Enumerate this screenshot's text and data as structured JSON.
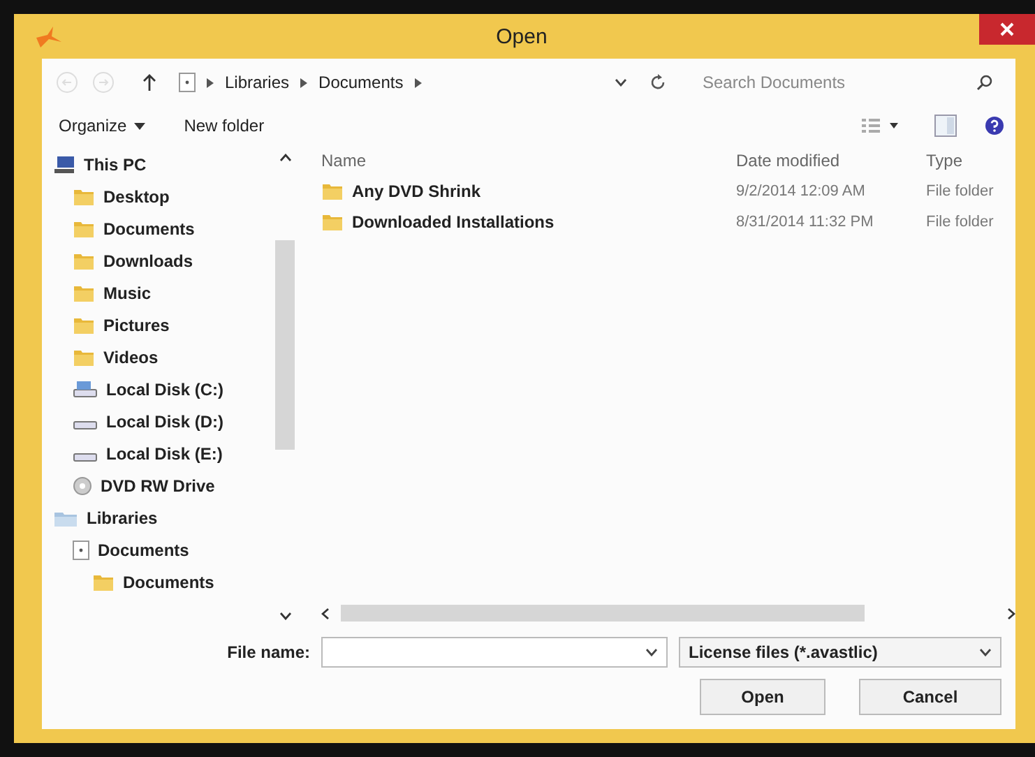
{
  "window": {
    "title": "Open"
  },
  "address": {
    "path": [
      "Libraries",
      "Documents"
    ]
  },
  "search": {
    "placeholder": "Search Documents"
  },
  "toolbar": {
    "organize": "Organize",
    "new_folder": "New folder"
  },
  "nav": [
    {
      "label": "This PC",
      "kind": "pc",
      "children": [
        {
          "label": "Desktop",
          "kind": "desktop"
        },
        {
          "label": "Documents",
          "kind": "folder"
        },
        {
          "label": "Downloads",
          "kind": "downloads"
        },
        {
          "label": "Music",
          "kind": "music"
        },
        {
          "label": "Pictures",
          "kind": "pictures"
        },
        {
          "label": "Videos",
          "kind": "videos"
        },
        {
          "label": "Local Disk (C:)",
          "kind": "system-disk"
        },
        {
          "label": "Local Disk (D:)",
          "kind": "disk"
        },
        {
          "label": "Local Disk (E:)",
          "kind": "disk"
        },
        {
          "label": "DVD RW Drive",
          "kind": "dvd"
        }
      ]
    },
    {
      "label": "Libraries",
      "kind": "libraries",
      "children": [
        {
          "label": "Documents",
          "kind": "library",
          "children": [
            {
              "label": "Documents",
              "kind": "folder"
            }
          ]
        }
      ]
    }
  ],
  "table": {
    "columns": [
      "Name",
      "Date modified",
      "Type"
    ],
    "rows": [
      {
        "name": "Any DVD Shrink",
        "date": "9/2/2014 12:09 AM",
        "type": "File folder"
      },
      {
        "name": "Downloaded Installations",
        "date": "8/31/2014 11:32 PM",
        "type": "File folder"
      }
    ]
  },
  "file_name": {
    "label": "File name:"
  },
  "filter": {
    "value": "License files (*.avastlic)"
  },
  "buttons": [
    "Open",
    "Cancel"
  ]
}
